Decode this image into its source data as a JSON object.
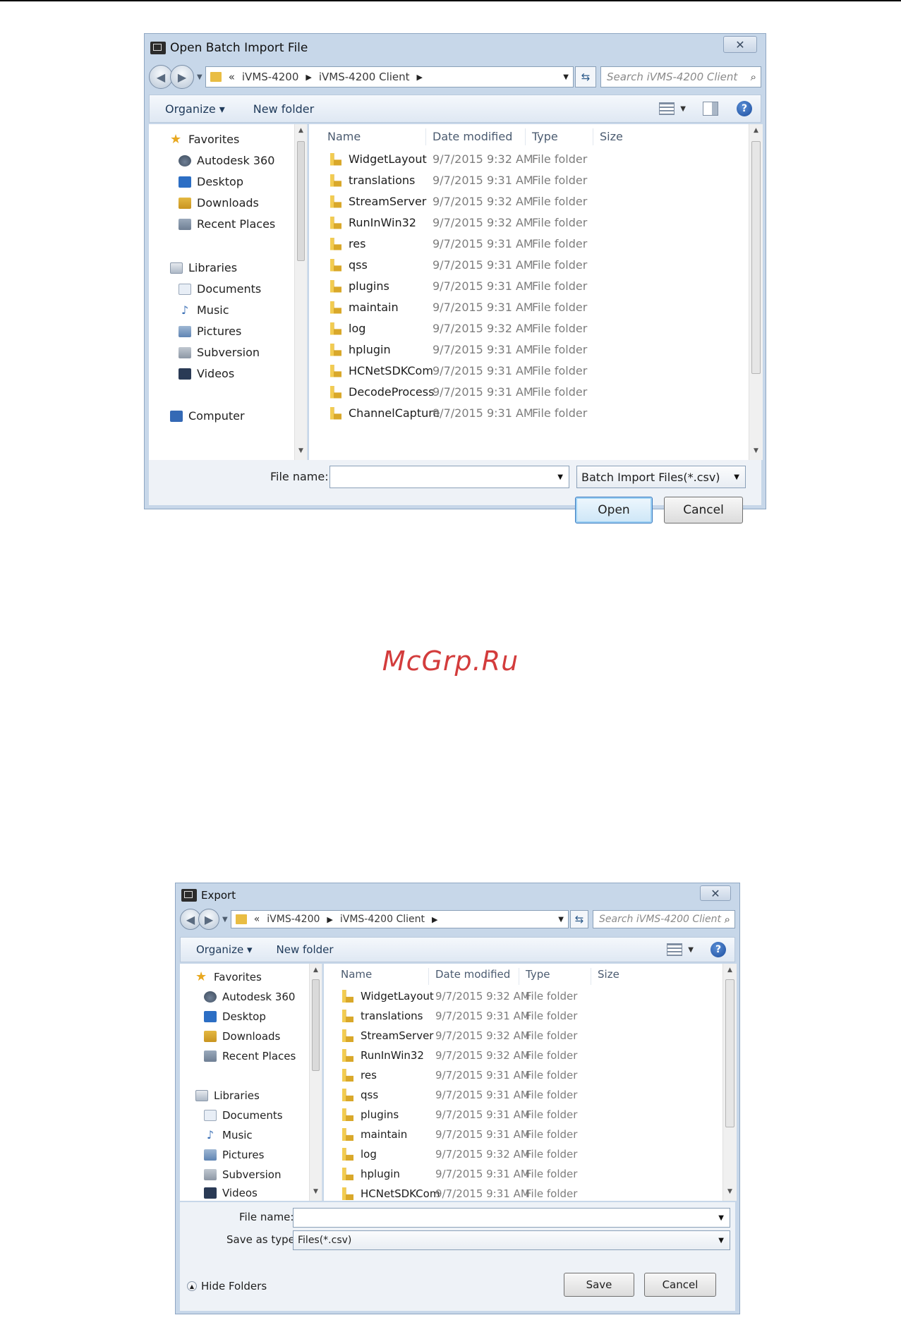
{
  "open_dialog": {
    "title": "Open Batch Import File",
    "close_glyph": "✕",
    "address": {
      "overflow": "«",
      "crumbs": [
        "iVMS-4200",
        "iVMS-4200 Client"
      ]
    },
    "search_placeholder": "Search iVMS-4200 Client",
    "toolbar": {
      "organize": "Organize ▾",
      "new_folder": "New folder"
    },
    "nav": [
      {
        "label": "Favorites",
        "icon": "star-icon"
      },
      {
        "label": "Autodesk 360",
        "icon": "cloud-icon"
      },
      {
        "label": "Desktop",
        "icon": "desktop-icon"
      },
      {
        "label": "Downloads",
        "icon": "downloads-icon"
      },
      {
        "label": "Recent Places",
        "icon": "recent-places-icon"
      },
      {
        "label": "Libraries",
        "icon": "libraries-icon"
      },
      {
        "label": "Documents",
        "icon": "documents-icon"
      },
      {
        "label": "Music",
        "icon": "music-icon"
      },
      {
        "label": "Pictures",
        "icon": "pictures-icon"
      },
      {
        "label": "Subversion",
        "icon": "subversion-icon"
      },
      {
        "label": "Videos",
        "icon": "videos-icon"
      },
      {
        "label": "Computer",
        "icon": "computer-icon"
      }
    ],
    "columns": [
      "Name",
      "Date modified",
      "Type",
      "Size"
    ],
    "files": [
      {
        "name": "WidgetLayout",
        "date": "9/7/2015 9:32 AM",
        "type": "File folder"
      },
      {
        "name": "translations",
        "date": "9/7/2015 9:31 AM",
        "type": "File folder"
      },
      {
        "name": "StreamServer",
        "date": "9/7/2015 9:32 AM",
        "type": "File folder"
      },
      {
        "name": "RunInWin32",
        "date": "9/7/2015 9:32 AM",
        "type": "File folder"
      },
      {
        "name": "res",
        "date": "9/7/2015 9:31 AM",
        "type": "File folder"
      },
      {
        "name": "qss",
        "date": "9/7/2015 9:31 AM",
        "type": "File folder"
      },
      {
        "name": "plugins",
        "date": "9/7/2015 9:31 AM",
        "type": "File folder"
      },
      {
        "name": "maintain",
        "date": "9/7/2015 9:31 AM",
        "type": "File folder"
      },
      {
        "name": "log",
        "date": "9/7/2015 9:32 AM",
        "type": "File folder"
      },
      {
        "name": "hplugin",
        "date": "9/7/2015 9:31 AM",
        "type": "File folder"
      },
      {
        "name": "HCNetSDKCom",
        "date": "9/7/2015 9:31 AM",
        "type": "File folder"
      },
      {
        "name": "DecodeProcess",
        "date": "9/7/2015 9:31 AM",
        "type": "File folder"
      },
      {
        "name": "ChannelCapture",
        "date": "9/7/2015 9:31 AM",
        "type": "File folder"
      }
    ],
    "file_name_label": "File name:",
    "file_name_value": "",
    "file_type": "Batch Import Files(*.csv)",
    "open_label": "Open",
    "cancel_label": "Cancel"
  },
  "watermark": "McGrp.Ru",
  "export_dialog": {
    "title": "Export",
    "close_glyph": "✕",
    "address": {
      "overflow": "«",
      "crumbs": [
        "iVMS-4200",
        "iVMS-4200 Client"
      ]
    },
    "search_placeholder": "Search iVMS-4200 Client",
    "toolbar": {
      "organize": "Organize ▾",
      "new_folder": "New folder"
    },
    "nav": [
      {
        "label": "Favorites",
        "icon": "star-icon"
      },
      {
        "label": "Autodesk 360",
        "icon": "cloud-icon"
      },
      {
        "label": "Desktop",
        "icon": "desktop-icon"
      },
      {
        "label": "Downloads",
        "icon": "downloads-icon"
      },
      {
        "label": "Recent Places",
        "icon": "recent-places-icon"
      },
      {
        "label": "Libraries",
        "icon": "libraries-icon"
      },
      {
        "label": "Documents",
        "icon": "documents-icon"
      },
      {
        "label": "Music",
        "icon": "music-icon"
      },
      {
        "label": "Pictures",
        "icon": "pictures-icon"
      },
      {
        "label": "Subversion",
        "icon": "subversion-icon"
      },
      {
        "label": "Videos",
        "icon": "videos-icon"
      }
    ],
    "columns": [
      "Name",
      "Date modified",
      "Type",
      "Size"
    ],
    "files": [
      {
        "name": "WidgetLayout",
        "date": "9/7/2015 9:32 AM",
        "type": "File folder"
      },
      {
        "name": "translations",
        "date": "9/7/2015 9:31 AM",
        "type": "File folder"
      },
      {
        "name": "StreamServer",
        "date": "9/7/2015 9:32 AM",
        "type": "File folder"
      },
      {
        "name": "RunInWin32",
        "date": "9/7/2015 9:32 AM",
        "type": "File folder"
      },
      {
        "name": "res",
        "date": "9/7/2015 9:31 AM",
        "type": "File folder"
      },
      {
        "name": "qss",
        "date": "9/7/2015 9:31 AM",
        "type": "File folder"
      },
      {
        "name": "plugins",
        "date": "9/7/2015 9:31 AM",
        "type": "File folder"
      },
      {
        "name": "maintain",
        "date": "9/7/2015 9:31 AM",
        "type": "File folder"
      },
      {
        "name": "log",
        "date": "9/7/2015 9:32 AM",
        "type": "File folder"
      },
      {
        "name": "hplugin",
        "date": "9/7/2015 9:31 AM",
        "type": "File folder"
      },
      {
        "name": "HCNetSDKCom",
        "date": "9/7/2015 9:31 AM",
        "type": "File folder"
      }
    ],
    "file_name_label": "File name:",
    "file_name_value": "",
    "save_type_label": "Save as type:",
    "save_type": "Files(*.csv)",
    "hide_folders": "Hide Folders",
    "save_label": "Save",
    "cancel_label": "Cancel"
  }
}
